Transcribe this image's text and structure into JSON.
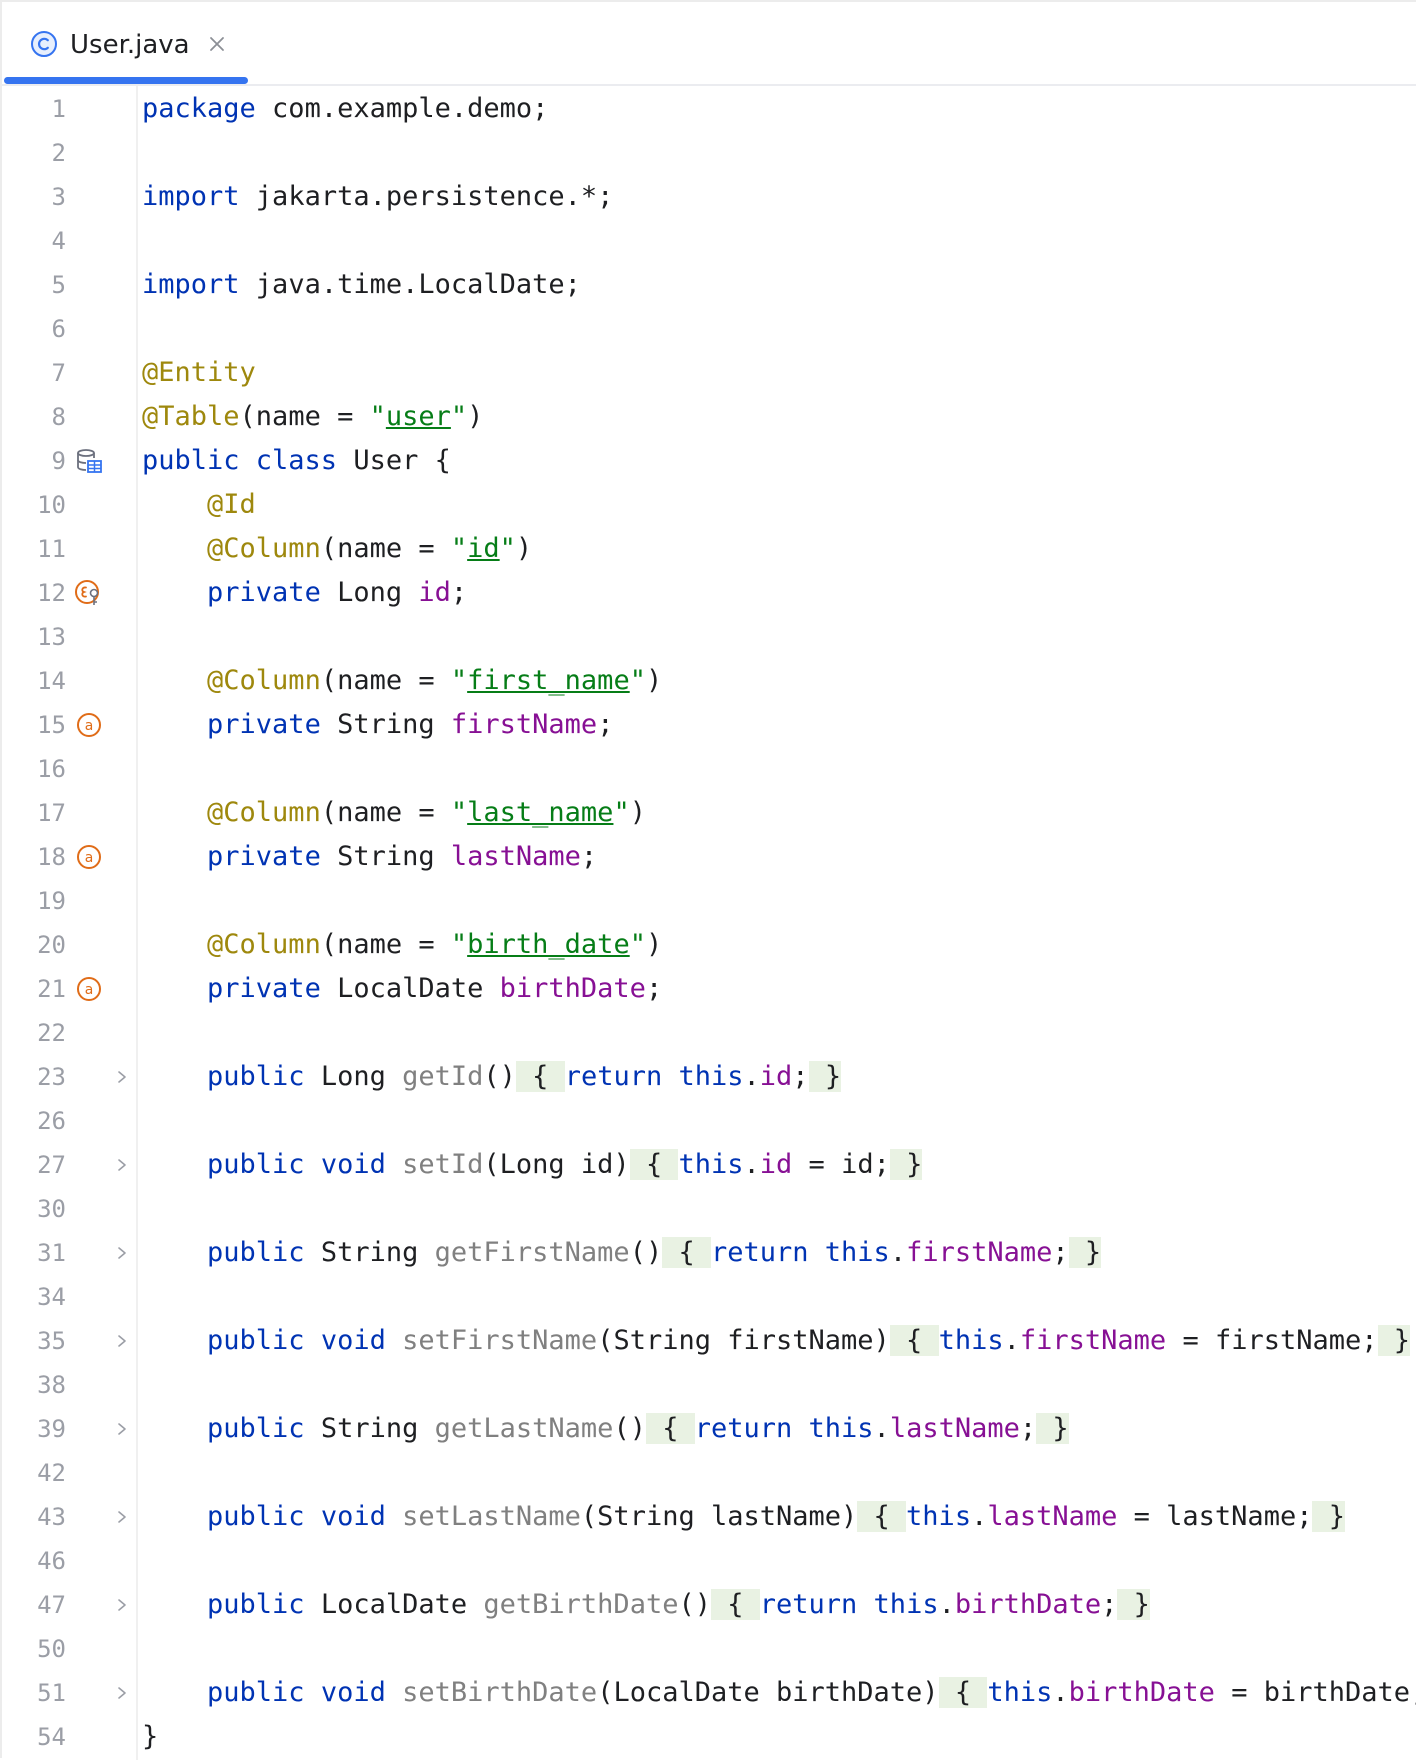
{
  "tab": {
    "filename": "User.java",
    "icon": "class-c-icon"
  },
  "colors": {
    "keyword": "#0033b3",
    "annotation": "#9e880d",
    "string": "#067d17",
    "field": "#871094",
    "method": "#808080",
    "line_number": "#9b9ea6",
    "tab_accent": "#3574f0",
    "fold_bg": "#e9f2e3",
    "gutter_icon": "#e06c18"
  },
  "lines": [
    {
      "n": "1",
      "indent": "",
      "t": [
        {
          "k": "kw",
          "v": "package"
        },
        {
          "v": " com.example.demo;"
        }
      ]
    },
    {
      "n": "2",
      "indent": "",
      "t": []
    },
    {
      "n": "3",
      "indent": "",
      "t": [
        {
          "k": "kw",
          "v": "import"
        },
        {
          "v": " jakarta.persistence.*;"
        }
      ]
    },
    {
      "n": "4",
      "indent": "",
      "t": []
    },
    {
      "n": "5",
      "indent": "",
      "t": [
        {
          "k": "kw",
          "v": "import"
        },
        {
          "v": " java.time.LocalDate;"
        }
      ]
    },
    {
      "n": "6",
      "indent": "",
      "t": []
    },
    {
      "n": "7",
      "indent": "",
      "t": [
        {
          "k": "ann",
          "v": "@Entity"
        }
      ]
    },
    {
      "n": "8",
      "indent": "",
      "t": [
        {
          "k": "ann",
          "v": "@Table"
        },
        {
          "v": "(name = "
        },
        {
          "k": "str",
          "v": "\""
        },
        {
          "k": "strv",
          "v": "user"
        },
        {
          "k": "str",
          "v": "\""
        },
        {
          "v": ")"
        }
      ]
    },
    {
      "n": "9",
      "indent": "",
      "gutter": "entity-table-icon",
      "t": [
        {
          "k": "kw",
          "v": "public class"
        },
        {
          "v": " User {"
        }
      ]
    },
    {
      "n": "10",
      "indent": "    ",
      "t": [
        {
          "k": "ann",
          "v": "@Id"
        }
      ]
    },
    {
      "n": "11",
      "indent": "    ",
      "t": [
        {
          "k": "ann",
          "v": "@Column"
        },
        {
          "v": "(name = "
        },
        {
          "k": "str",
          "v": "\""
        },
        {
          "k": "strv",
          "v": "id"
        },
        {
          "k": "str",
          "v": "\""
        },
        {
          "v": ")"
        }
      ]
    },
    {
      "n": "12",
      "indent": "    ",
      "gutter": "id-field-icon",
      "t": [
        {
          "k": "kw",
          "v": "private"
        },
        {
          "v": " Long "
        },
        {
          "k": "fld",
          "v": "id"
        },
        {
          "v": ";"
        }
      ]
    },
    {
      "n": "13",
      "indent": "",
      "t": []
    },
    {
      "n": "14",
      "indent": "    ",
      "t": [
        {
          "k": "ann",
          "v": "@Column"
        },
        {
          "v": "(name = "
        },
        {
          "k": "str",
          "v": "\""
        },
        {
          "k": "strv",
          "v": "first_name"
        },
        {
          "k": "str",
          "v": "\""
        },
        {
          "v": ")"
        }
      ]
    },
    {
      "n": "15",
      "indent": "    ",
      "gutter": "attribute-field-icon",
      "t": [
        {
          "k": "kw",
          "v": "private"
        },
        {
          "v": " String "
        },
        {
          "k": "fld",
          "v": "firstName"
        },
        {
          "v": ";"
        }
      ]
    },
    {
      "n": "16",
      "indent": "",
      "t": []
    },
    {
      "n": "17",
      "indent": "    ",
      "t": [
        {
          "k": "ann",
          "v": "@Column"
        },
        {
          "v": "(name = "
        },
        {
          "k": "str",
          "v": "\""
        },
        {
          "k": "strv",
          "v": "last_name"
        },
        {
          "k": "str",
          "v": "\""
        },
        {
          "v": ")"
        }
      ]
    },
    {
      "n": "18",
      "indent": "    ",
      "gutter": "attribute-field-icon",
      "t": [
        {
          "k": "kw",
          "v": "private"
        },
        {
          "v": " String "
        },
        {
          "k": "fld",
          "v": "lastName"
        },
        {
          "v": ";"
        }
      ]
    },
    {
      "n": "19",
      "indent": "",
      "t": []
    },
    {
      "n": "20",
      "indent": "    ",
      "t": [
        {
          "k": "ann",
          "v": "@Column"
        },
        {
          "v": "(name = "
        },
        {
          "k": "str",
          "v": "\""
        },
        {
          "k": "strv",
          "v": "birth_date"
        },
        {
          "k": "str",
          "v": "\""
        },
        {
          "v": ")"
        }
      ]
    },
    {
      "n": "21",
      "indent": "    ",
      "gutter": "attribute-field-icon",
      "t": [
        {
          "k": "kw",
          "v": "private"
        },
        {
          "v": " LocalDate "
        },
        {
          "k": "fld",
          "v": "birthDate"
        },
        {
          "v": ";"
        }
      ]
    },
    {
      "n": "22",
      "indent": "",
      "t": []
    },
    {
      "n": "23",
      "indent": "    ",
      "fold": true,
      "t": [
        {
          "k": "kw",
          "v": "public"
        },
        {
          "v": " Long "
        },
        {
          "k": "mth",
          "v": "getId"
        },
        {
          "v": "()"
        },
        {
          "k": "br",
          "v": " { "
        },
        {
          "k": "kw",
          "v": "return this"
        },
        {
          "v": "."
        },
        {
          "k": "fld",
          "v": "id"
        },
        {
          "v": ";"
        },
        {
          "k": "br",
          "v": " }"
        }
      ]
    },
    {
      "n": "26",
      "indent": "",
      "t": []
    },
    {
      "n": "27",
      "indent": "    ",
      "fold": true,
      "t": [
        {
          "k": "kw",
          "v": "public void"
        },
        {
          "v": " "
        },
        {
          "k": "mth",
          "v": "setId"
        },
        {
          "v": "(Long id)"
        },
        {
          "k": "br",
          "v": " { "
        },
        {
          "k": "kw",
          "v": "this"
        },
        {
          "v": "."
        },
        {
          "k": "fld",
          "v": "id"
        },
        {
          "v": " = id;"
        },
        {
          "k": "br",
          "v": " }"
        }
      ]
    },
    {
      "n": "30",
      "indent": "",
      "t": []
    },
    {
      "n": "31",
      "indent": "    ",
      "fold": true,
      "t": [
        {
          "k": "kw",
          "v": "public"
        },
        {
          "v": " String "
        },
        {
          "k": "mth",
          "v": "getFirstName"
        },
        {
          "v": "()"
        },
        {
          "k": "br",
          "v": " { "
        },
        {
          "k": "kw",
          "v": "return this"
        },
        {
          "v": "."
        },
        {
          "k": "fld",
          "v": "firstName"
        },
        {
          "v": ";"
        },
        {
          "k": "br",
          "v": " }"
        }
      ]
    },
    {
      "n": "34",
      "indent": "",
      "t": []
    },
    {
      "n": "35",
      "indent": "    ",
      "fold": true,
      "t": [
        {
          "k": "kw",
          "v": "public void"
        },
        {
          "v": " "
        },
        {
          "k": "mth",
          "v": "setFirstName"
        },
        {
          "v": "(String firstName)"
        },
        {
          "k": "br",
          "v": " { "
        },
        {
          "k": "kw",
          "v": "this"
        },
        {
          "v": "."
        },
        {
          "k": "fld",
          "v": "firstName"
        },
        {
          "v": " = firstName;"
        },
        {
          "k": "br",
          "v": " }"
        }
      ]
    },
    {
      "n": "38",
      "indent": "",
      "t": []
    },
    {
      "n": "39",
      "indent": "    ",
      "fold": true,
      "t": [
        {
          "k": "kw",
          "v": "public"
        },
        {
          "v": " String "
        },
        {
          "k": "mth",
          "v": "getLastName"
        },
        {
          "v": "()"
        },
        {
          "k": "br",
          "v": " { "
        },
        {
          "k": "kw",
          "v": "return this"
        },
        {
          "v": "."
        },
        {
          "k": "fld",
          "v": "lastName"
        },
        {
          "v": ";"
        },
        {
          "k": "br",
          "v": " }"
        }
      ]
    },
    {
      "n": "42",
      "indent": "",
      "t": []
    },
    {
      "n": "43",
      "indent": "    ",
      "fold": true,
      "t": [
        {
          "k": "kw",
          "v": "public void"
        },
        {
          "v": " "
        },
        {
          "k": "mth",
          "v": "setLastName"
        },
        {
          "v": "(String lastName)"
        },
        {
          "k": "br",
          "v": " { "
        },
        {
          "k": "kw",
          "v": "this"
        },
        {
          "v": "."
        },
        {
          "k": "fld",
          "v": "lastName"
        },
        {
          "v": " = lastName;"
        },
        {
          "k": "br",
          "v": " }"
        }
      ]
    },
    {
      "n": "46",
      "indent": "",
      "t": []
    },
    {
      "n": "47",
      "indent": "    ",
      "fold": true,
      "t": [
        {
          "k": "kw",
          "v": "public"
        },
        {
          "v": " LocalDate "
        },
        {
          "k": "mth",
          "v": "getBirthDate"
        },
        {
          "v": "()"
        },
        {
          "k": "br",
          "v": " { "
        },
        {
          "k": "kw",
          "v": "return this"
        },
        {
          "v": "."
        },
        {
          "k": "fld",
          "v": "birthDate"
        },
        {
          "v": ";"
        },
        {
          "k": "br",
          "v": " }"
        }
      ]
    },
    {
      "n": "50",
      "indent": "",
      "t": []
    },
    {
      "n": "51",
      "indent": "    ",
      "fold": true,
      "t": [
        {
          "k": "kw",
          "v": "public void"
        },
        {
          "v": " "
        },
        {
          "k": "mth",
          "v": "setBirthDate"
        },
        {
          "v": "(LocalDate birthDate)"
        },
        {
          "k": "br",
          "v": " { "
        },
        {
          "k": "kw",
          "v": "this"
        },
        {
          "v": "."
        },
        {
          "k": "fld",
          "v": "birthDate"
        },
        {
          "v": " = birthDate;"
        },
        {
          "k": "br",
          "v": " }"
        }
      ]
    },
    {
      "n": "54",
      "indent": "",
      "t": [
        {
          "v": "}"
        }
      ]
    }
  ]
}
